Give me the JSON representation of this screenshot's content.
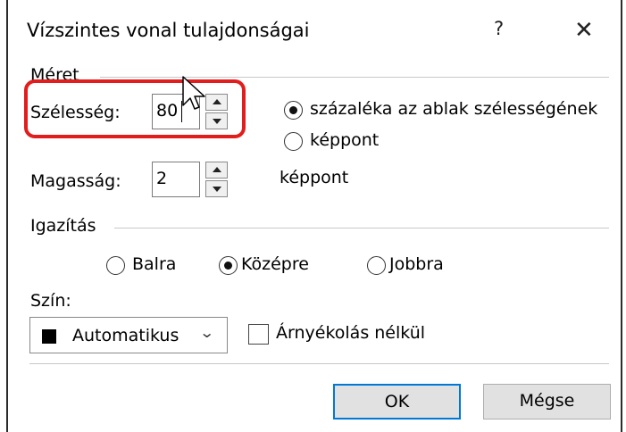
{
  "dialog": {
    "title": "Vízszintes vonal tulajdonságai",
    "help_glyph": "?",
    "close_glyph": "✕"
  },
  "size_section": {
    "label": "Méret",
    "width_label": "Szélesség:",
    "width_value": "80",
    "height_label": "Magasság:",
    "height_value": "2",
    "height_unit": "képpont",
    "width_unit_options": [
      {
        "label": "százaléka az ablak szélességének",
        "selected": true
      },
      {
        "label": "képpont",
        "selected": false
      }
    ]
  },
  "alignment_section": {
    "label": "Igazítás",
    "options": [
      {
        "label": "Balra",
        "selected": false
      },
      {
        "label": "Középre",
        "selected": true
      },
      {
        "label": "Jobbra",
        "selected": false
      }
    ]
  },
  "color_section": {
    "label": "Szín:",
    "selected_color": "Automatikus",
    "swatch_color": "#000000",
    "shade_checkbox_label": "Árnyékolás nélkül",
    "shade_checked": false
  },
  "buttons": {
    "ok": "OK",
    "cancel": "Mégse"
  },
  "colors": {
    "highlight": "#e21d1d",
    "default_button_border": "#0078d7"
  }
}
